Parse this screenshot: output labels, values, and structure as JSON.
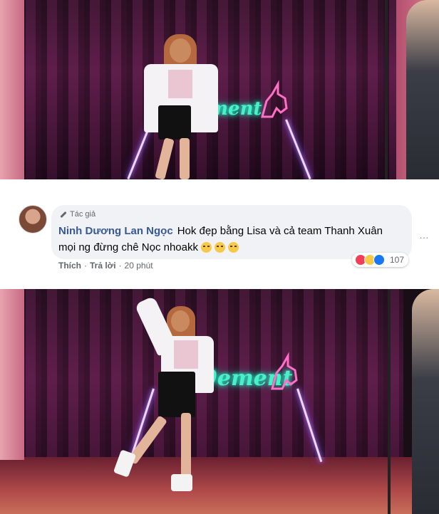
{
  "comment": {
    "author_badge": "Tác giả",
    "author_name": "Ninh Dương Lan Ngọc",
    "text_line1": "Hok đẹp bằng Lisa và cả team Thanh Xuân",
    "text_line2": "mọi ng đừng chê Nọc nhoakk",
    "reaction_count": "107",
    "actions": {
      "like": "Thích",
      "separator": "·",
      "reply": "Trả lời",
      "time": "20 phút"
    },
    "more": "…"
  },
  "scene": {
    "neon_sign_top": "ement",
    "neon_sign_bottom": "9ement"
  },
  "colors": {
    "name_blue": "#385898",
    "bubble_bg": "#f0f2f5",
    "neon_green": "#4af0c8",
    "neon_pink": "#ff6ec7"
  }
}
